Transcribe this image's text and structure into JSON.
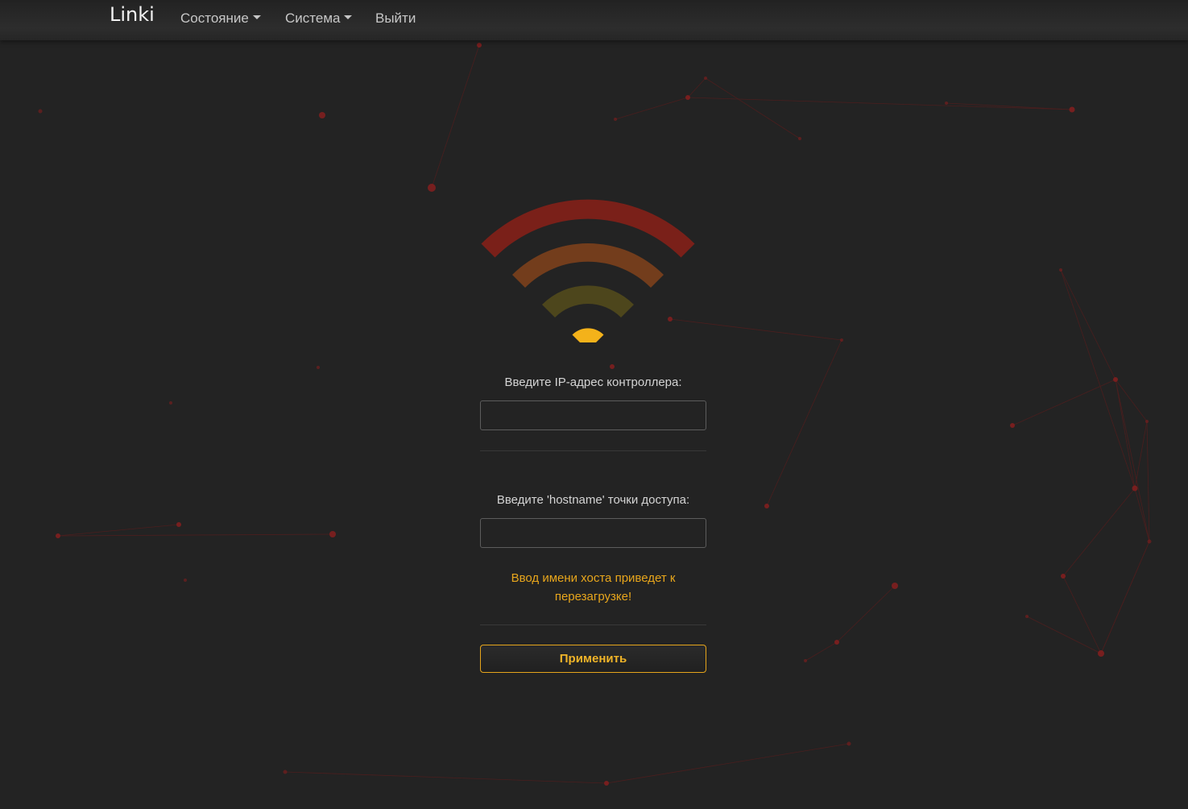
{
  "navbar": {
    "brand": "Linki",
    "items": [
      {
        "label": "Состояние",
        "dropdown": true
      },
      {
        "label": "Система",
        "dropdown": true
      },
      {
        "label": "Выйти",
        "dropdown": false
      }
    ]
  },
  "logo": {
    "icon": "wifi-signal-icon",
    "colors": {
      "outer_arc": "#7a2019",
      "middle_arc": "#733d1c",
      "inner_arc": "#4d461c",
      "dot": "#f4b21a"
    }
  },
  "form": {
    "ip_label": "Введите IP-адрес контроллера:",
    "ip_value": "",
    "hostname_label": "Введите 'hostname' точки доступа:",
    "hostname_value": "",
    "warning": "Ввод имени хоста приведет к перезагрузке!",
    "apply_label": "Применить"
  },
  "colors": {
    "background": "#232323",
    "accent": "#e8a61c",
    "network_particles": "#8b1e1e"
  }
}
